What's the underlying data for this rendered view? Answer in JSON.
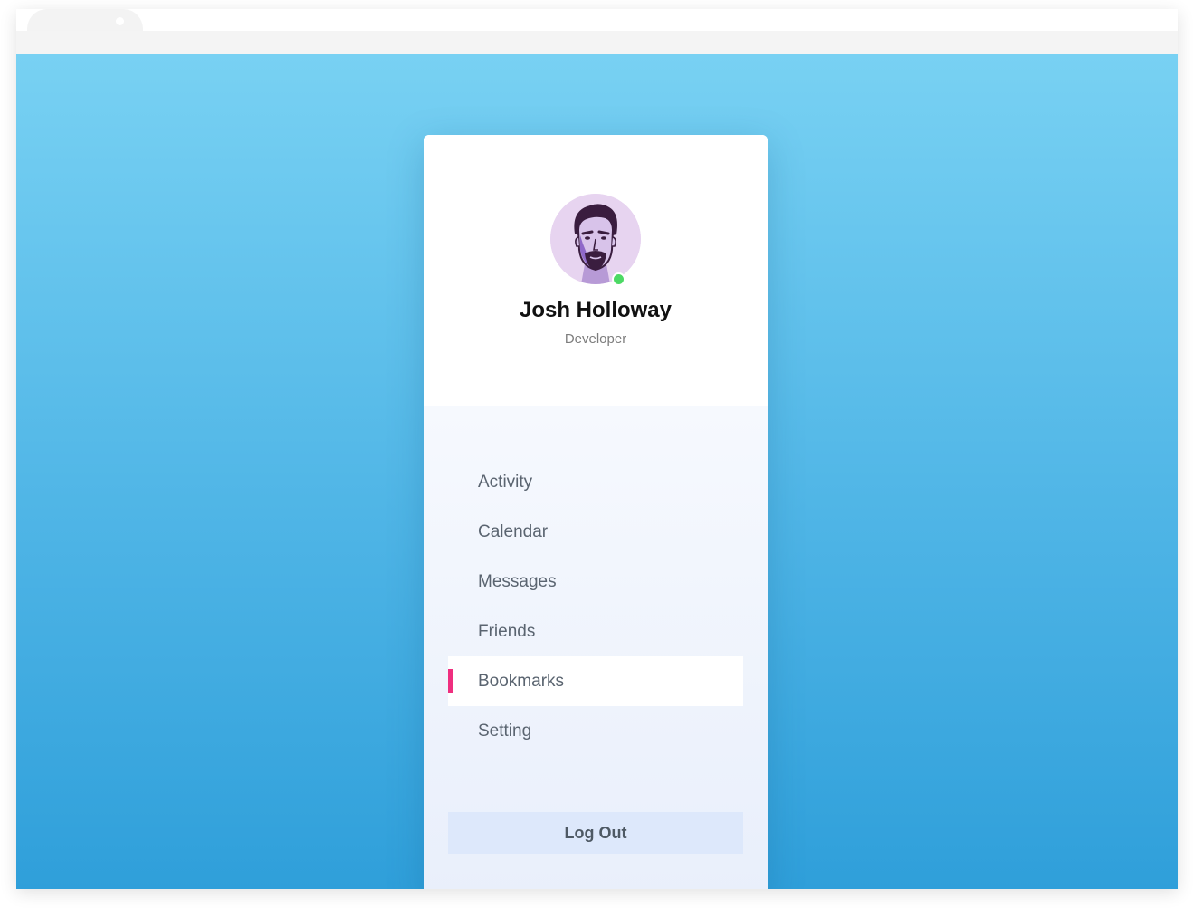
{
  "profile": {
    "name": "Josh Holloway",
    "role": "Developer",
    "status": "online"
  },
  "menu": {
    "items": [
      {
        "label": "Activity"
      },
      {
        "label": "Calendar"
      },
      {
        "label": "Messages"
      },
      {
        "label": "Friends"
      },
      {
        "label": "Bookmarks",
        "active": true
      },
      {
        "label": "Setting"
      }
    ],
    "logout_label": "Log Out"
  },
  "colors": {
    "background_top": "#78d1f3",
    "background_bottom": "#2f9fda",
    "active_indicator": "#ef2f7f",
    "status_online": "#4cd964",
    "logout_background": "#dde8fb"
  },
  "icons": [
    "avatar-illustration",
    "online-status-dot"
  ]
}
